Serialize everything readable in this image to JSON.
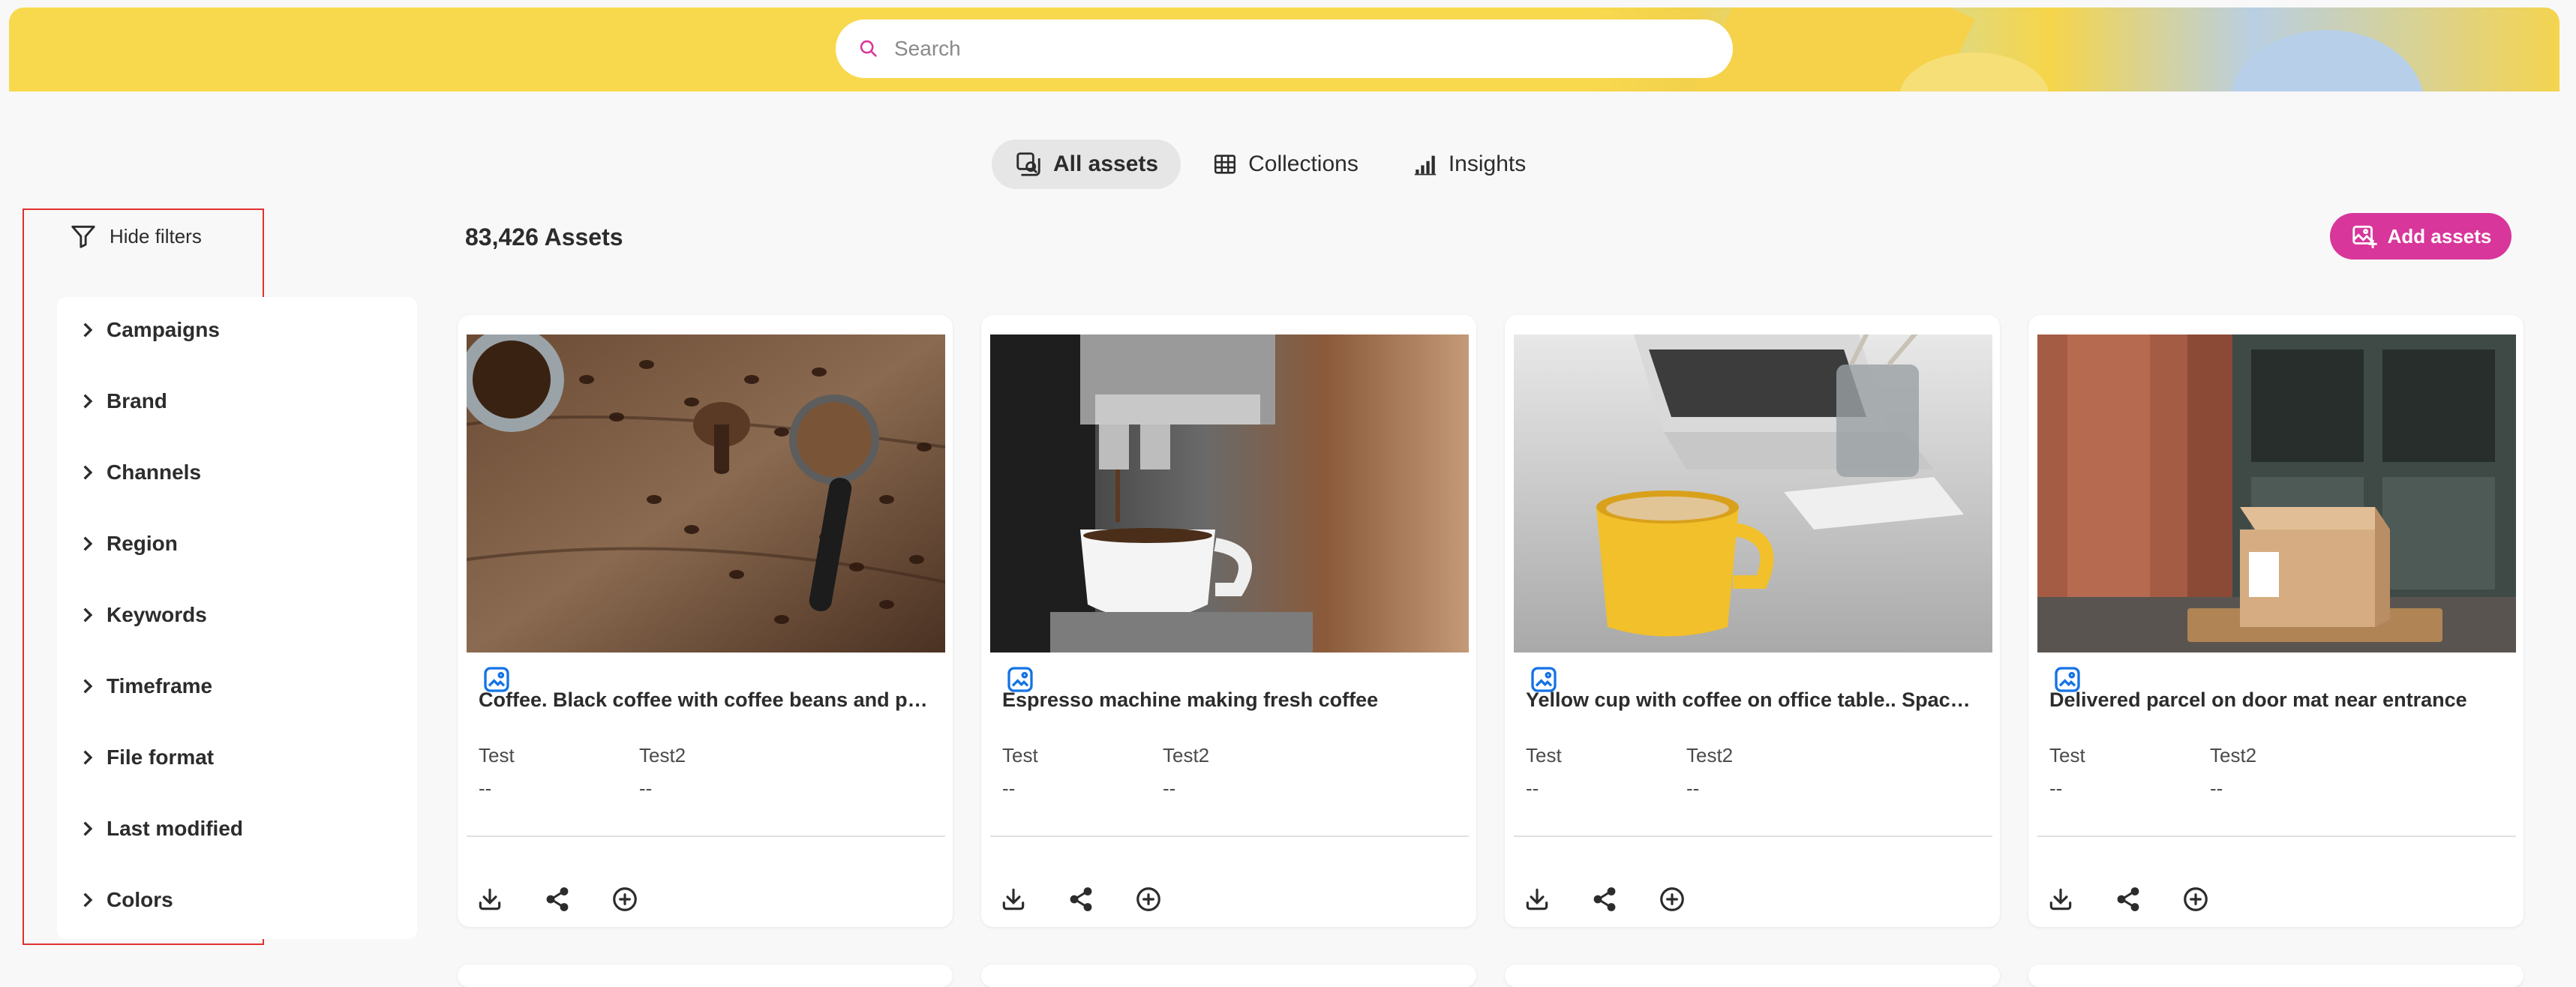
{
  "search": {
    "placeholder": "Search",
    "value": ""
  },
  "tabs": [
    {
      "label": "All assets",
      "icon": "all-assets-icon",
      "active": true
    },
    {
      "label": "Collections",
      "icon": "grid-icon",
      "active": false
    },
    {
      "label": "Insights",
      "icon": "bar-chart-icon",
      "active": false
    }
  ],
  "filters": {
    "toggle_label": "Hide filters",
    "facets": [
      "Campaigns",
      "Brand",
      "Channels",
      "Region",
      "Keywords",
      "Timeframe",
      "File format",
      "Last modified",
      "Colors"
    ]
  },
  "assets": {
    "count_label": "83,426 Assets",
    "add_label": "Add assets",
    "cards": [
      {
        "title": "Coffee. Black coffee with coffee beans and po...",
        "meta": [
          {
            "label": "Test",
            "value": "--"
          },
          {
            "label": "Test2",
            "value": "--"
          }
        ],
        "type_icon": "image-icon"
      },
      {
        "title": "Espresso machine making fresh coffee",
        "meta": [
          {
            "label": "Test",
            "value": "--"
          },
          {
            "label": "Test2",
            "value": "--"
          }
        ],
        "type_icon": "image-icon"
      },
      {
        "title": "Yellow cup with coffee on office table.. Space ...",
        "meta": [
          {
            "label": "Test",
            "value": "--"
          },
          {
            "label": "Test2",
            "value": "--"
          }
        ],
        "type_icon": "image-icon"
      },
      {
        "title": "Delivered parcel on door mat near entrance",
        "meta": [
          {
            "label": "Test",
            "value": "--"
          },
          {
            "label": "Test2",
            "value": "--"
          }
        ],
        "type_icon": "image-icon"
      }
    ],
    "card_actions": [
      "download-icon",
      "share-icon",
      "add-circle-icon"
    ]
  },
  "colors": {
    "accent": "#d8369b",
    "banner": "#f8d94e",
    "selection_outline": "#e0312f"
  }
}
